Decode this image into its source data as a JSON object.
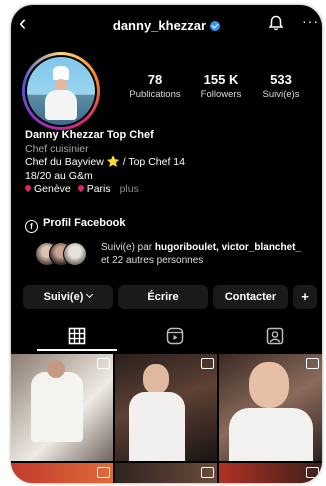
{
  "header": {
    "username": "danny_khezzar",
    "back_glyph": "‹",
    "more_glyph": "···"
  },
  "stats": [
    {
      "value": "78",
      "label": "Publications"
    },
    {
      "value": "155 K",
      "label": "Followers"
    },
    {
      "value": "533",
      "label": "Suivi(e)s"
    }
  ],
  "bio": {
    "name": "Danny Khezzar Top Chef",
    "category": "Chef cuisinier",
    "line1": "Chef du Bayview ⭐ / Top Chef 14",
    "line2": "18/20 au G&m",
    "loc1": "Genève",
    "loc2": "Paris",
    "plus": "plus",
    "facebook": "Profil Facebook",
    "fb_glyph": "f"
  },
  "followed_by": {
    "prefix": "Suivi(e) par",
    "names": "hugoriboulet, victor_blanchet_",
    "suffix": "et 22 autres personnes"
  },
  "actions": {
    "following": "Suivi(e)",
    "message": "Écrire",
    "contact": "Contacter",
    "add_user_glyph": "+"
  },
  "colors": {
    "background": "#000000",
    "verified": "#3897f0",
    "button_bg": "#1a1a1a"
  },
  "icons": [
    "back-icon",
    "verified-badge-icon",
    "bell-icon",
    "more-icon",
    "facebook-icon",
    "add-user-icon",
    "grid-icon",
    "reels-icon",
    "tagged-icon",
    "reel-badge-icon"
  ]
}
